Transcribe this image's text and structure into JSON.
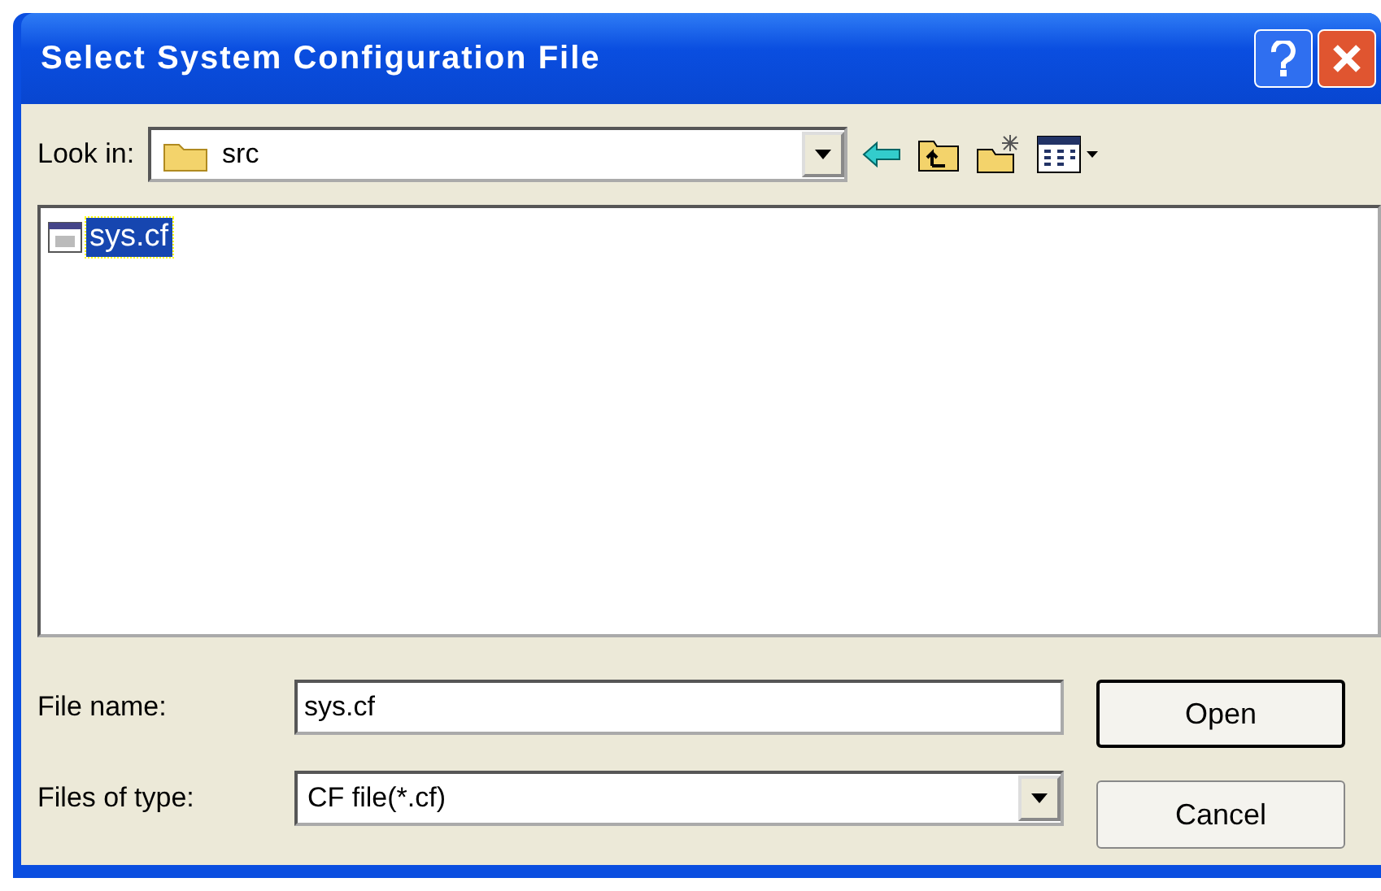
{
  "window": {
    "title": "Select System Configuration File"
  },
  "look_in": {
    "label": "Look in:",
    "value": "src"
  },
  "files": [
    {
      "name": "sys.cf",
      "selected": true
    }
  ],
  "file_name": {
    "label": "File name:",
    "value": "sys.cf"
  },
  "file_type": {
    "label": "Files of type:",
    "value": "CF file(*.cf)"
  },
  "buttons": [
    {
      "label": "Open",
      "default": true
    },
    {
      "label": "Cancel",
      "default": false
    }
  ]
}
